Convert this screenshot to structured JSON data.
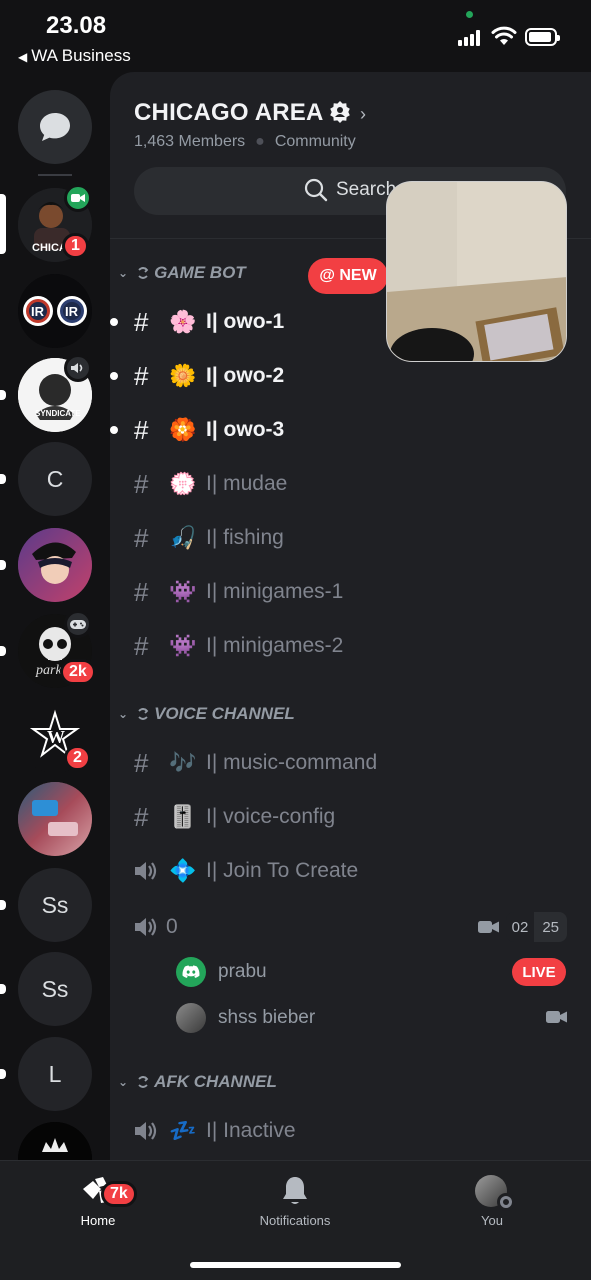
{
  "status_bar": {
    "time": "23.08",
    "back_app": "WA Business"
  },
  "rail": {
    "items": [
      {
        "type": "dm",
        "icon": "chat-bubble-icon"
      },
      {
        "type": "server",
        "name": "CHICA",
        "badge": "1",
        "sub_icon": "video-camera-icon"
      },
      {
        "type": "server",
        "name": "IR logos"
      },
      {
        "type": "server",
        "name": "Syndicate",
        "sub_icon": "speaker-icon"
      },
      {
        "type": "server",
        "letter": "C"
      },
      {
        "type": "server",
        "name": "anime avatar"
      },
      {
        "type": "server",
        "name": "parker",
        "badge": "2k",
        "sub_icon": "gamepad-icon"
      },
      {
        "type": "server",
        "name": "W star",
        "badge": "2"
      },
      {
        "type": "server",
        "name": "photo"
      },
      {
        "type": "server",
        "letter": "Ss"
      },
      {
        "type": "server",
        "letter": "Ss"
      },
      {
        "type": "server",
        "letter": "L"
      }
    ]
  },
  "server": {
    "name": "CHICAGO AREA",
    "members": "1,463 Members",
    "type": "Community",
    "search_label": "Search"
  },
  "new_pill": "@ NEW",
  "categories": [
    {
      "name": "GAME BOT"
    },
    {
      "name": "VOICE CHANNEL"
    },
    {
      "name": "AFK CHANNEL"
    }
  ],
  "channels": {
    "owo1": {
      "emoji": "🌸",
      "name": "I| owo-1"
    },
    "owo2": {
      "emoji": "🌼",
      "name": "I| owo-2"
    },
    "owo3": {
      "emoji": "🏵️",
      "name": "I| owo-3"
    },
    "mudae": {
      "emoji": "💮",
      "name": "I| mudae"
    },
    "fishing": {
      "emoji": "🎣",
      "name": "I| fishing"
    },
    "minigames1": {
      "emoji": "👾",
      "name": "I| minigames-1"
    },
    "minigames2": {
      "emoji": "👾",
      "name": "I| minigames-2"
    },
    "music": {
      "emoji": "🎶",
      "name": "I| music-command"
    },
    "voiceconfig": {
      "emoji": "🎚️",
      "name": "I| voice-config"
    },
    "join": {
      "emoji": "💠",
      "name": "I| Join To Create"
    },
    "zero": {
      "name": "0",
      "user_count": "02",
      "user_limit": "25"
    },
    "inactive": {
      "emoji": "💤",
      "name": "I| Inactive"
    }
  },
  "voice_users": [
    {
      "name": "prabu",
      "status": "LIVE"
    },
    {
      "name": "shss bieber"
    }
  ],
  "tabs": [
    {
      "label": "Home",
      "badge": "7k"
    },
    {
      "label": "Notifications"
    },
    {
      "label": "You"
    }
  ],
  "colors": {
    "accent_red": "#f23f43",
    "online_green": "#23a55a",
    "blurple": "#5865f2"
  }
}
